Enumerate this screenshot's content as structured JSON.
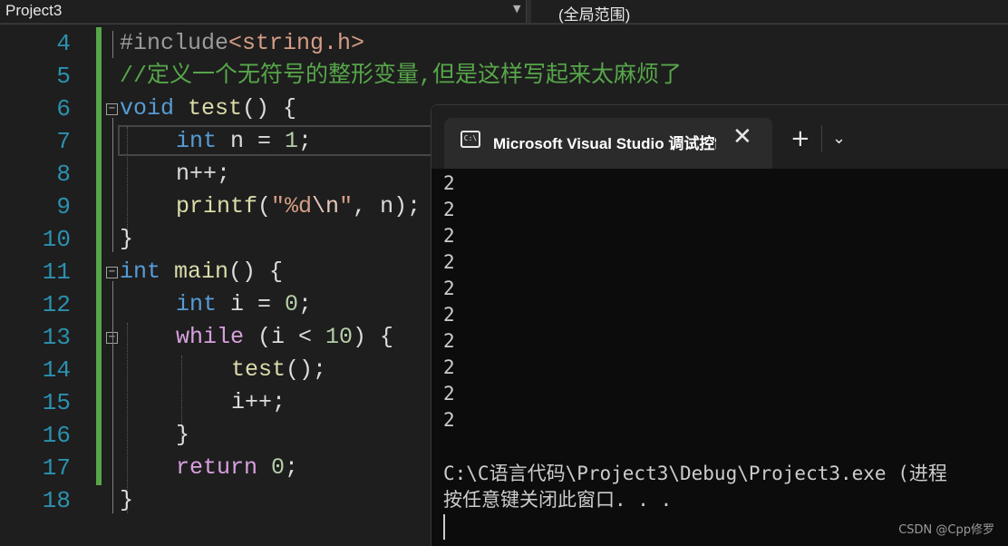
{
  "navbar": {
    "project_selector": "Project3",
    "scope_selector": "(全局范围)"
  },
  "editor": {
    "line_numbers": [
      "4",
      "5",
      "6",
      "7",
      "8",
      "9",
      "10",
      "11",
      "12",
      "13",
      "14",
      "15",
      "16",
      "17",
      "18"
    ],
    "lines": {
      "l4": {
        "a": "#include",
        "b": "<string.h>"
      },
      "l5": {
        "a": "//定义一个无符号的整形变量,但是这样写起来太麻烦了"
      },
      "l6": {
        "a": "void",
        "b": " ",
        "c": "test",
        "d": "() {"
      },
      "l7": {
        "a": "int",
        "b": " n = ",
        "c": "1",
        "d": ";"
      },
      "l8": {
        "a": "n++;"
      },
      "l9": {
        "a": "printf",
        "b": "(",
        "c": "\"%d",
        "d": "\\n",
        "e": "\"",
        "f": ", n);"
      },
      "l10": {
        "a": "}"
      },
      "l11": {
        "a": "int",
        "b": " ",
        "c": "main",
        "d": "() {"
      },
      "l12": {
        "a": "int",
        "b": " i = ",
        "c": "0",
        "d": ";"
      },
      "l13": {
        "a": "while",
        "b": " (i < ",
        "c": "10",
        "d": ") {"
      },
      "l14": {
        "a": "test",
        "b": "();"
      },
      "l15": {
        "a": "i++;"
      },
      "l16": {
        "a": "}"
      },
      "l17": {
        "a": "return",
        "b": " ",
        "c": "0",
        "d": ";"
      },
      "l18": {
        "a": "}"
      }
    },
    "fold_glyph": "−"
  },
  "terminal": {
    "tab_icon_text": "C:\\",
    "tab_title": "Microsoft Visual Studio 调试控制台",
    "close_glyph": "✕",
    "new_tab_glyph": "+",
    "dropdown_glyph": "⌄",
    "output": [
      "2",
      "2",
      "2",
      "2",
      "2",
      "2",
      "2",
      "2",
      "2",
      "2"
    ],
    "exit_path": "C:\\C语言代码\\Project3\\Debug\\Project3.exe (进程",
    "close_prompt": "按任意键关闭此窗口. . ."
  },
  "watermark": "CSDN @Cpp修罗",
  "colors": {
    "keyword": "#569cd6",
    "control": "#d8a0df",
    "function": "#dcdcaa",
    "string": "#d69d85",
    "number": "#b5cea8",
    "comment": "#57a64a",
    "line_number": "#2b91af",
    "background": "#1e1e1e"
  }
}
